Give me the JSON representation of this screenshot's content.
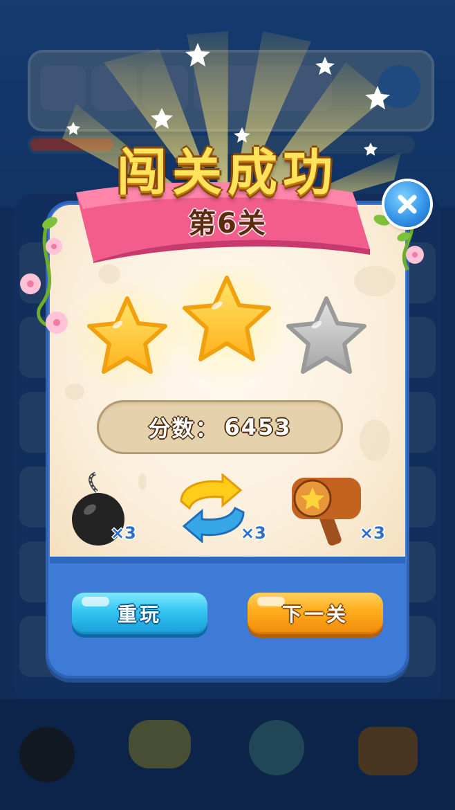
{
  "popup": {
    "title": "闯关成功",
    "level": "第6关",
    "stars_earned": 2,
    "stars_total": 3,
    "score": {
      "label": "分数：",
      "value": "6453"
    },
    "rewards": [
      {
        "name": "bomb",
        "count": "×3"
      },
      {
        "name": "swap",
        "count": "×3"
      },
      {
        "name": "hammer",
        "count": "×3"
      }
    ],
    "buttons": {
      "replay": "重玩",
      "next": "下一关"
    },
    "close_icon": "close-icon"
  },
  "colors": {
    "title_fill": "#ffe35a",
    "ribbon": "#f25d8e",
    "panel_blue": "#3d7bd6",
    "star_gold": "#ffc52e",
    "star_empty": "#b9b9b9",
    "replay_button": "#33c5f0",
    "next_button": "#ffac1c"
  }
}
